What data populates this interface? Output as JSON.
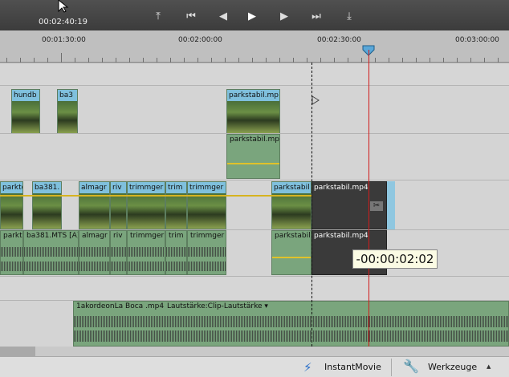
{
  "transport": {
    "timecode": "00:02:40:19",
    "buttons": {
      "go_to_in": "⤒",
      "previous_edit": "⏮",
      "step_back": "◀",
      "play": "▶",
      "step_forward": "▶",
      "next_edit": "⏭",
      "go_to_out": "⤓"
    }
  },
  "ruler": {
    "labels": [
      "00:01:30:00",
      "00:02:00:00",
      "00:02:30:00",
      "00:03:00:00"
    ]
  },
  "video_track_1": {
    "clips": [
      "hundb",
      "ba3",
      "parkstabil.mp"
    ]
  },
  "audio_track_1": {
    "clips": [
      "parkstabil.mp"
    ]
  },
  "video_track_2": {
    "clips": [
      "parkto",
      "ba381.",
      "almagr",
      "riv",
      "trimmger",
      "trim",
      "trimmger",
      "parkstabil"
    ],
    "selected_clip": "parkstabil.mp4"
  },
  "audio_track_2": {
    "clips": [
      "parktou",
      "ba381.MTS [A]",
      "almagr",
      "riv",
      "trimmger",
      "trim",
      "trimmger",
      "parkstabil"
    ],
    "selected_clip": "parkstabil.mp4"
  },
  "tooltip": {
    "text": "-00:00:02:02"
  },
  "music_track": {
    "clip_name": "1akordeonLa Boca .mp4",
    "volume_label": "Lautstärke:Clip-Lautstärke ▾"
  },
  "bottom_bar": {
    "instant_movie": "InstantMovie",
    "tools": "Werkzeuge",
    "tools_arrow": "▲"
  },
  "colors": {
    "playhead": "#d01c1c",
    "video_header": "#7fc0dd",
    "audio_clip": "#7aa57d",
    "volume_line": "#e0c22a"
  }
}
